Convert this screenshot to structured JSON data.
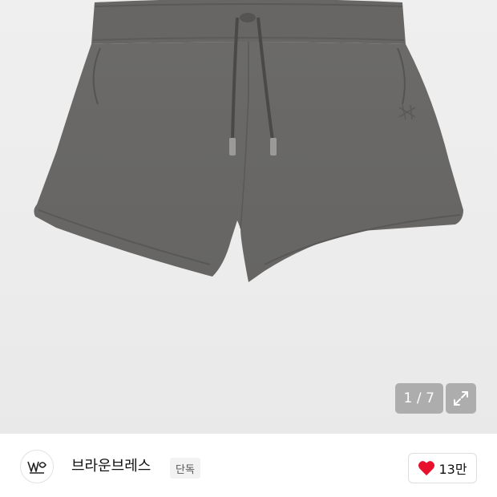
{
  "gallery": {
    "image_alt": "gray sweat shorts",
    "current_page": "1",
    "separator": "/",
    "total_pages": "7",
    "expand_icon": "expand-arrows-icon"
  },
  "brand": {
    "name": "브라운브레스",
    "badge": "단독",
    "logo_icon": "brand-logo-icon"
  },
  "like": {
    "icon": "heart-icon",
    "count": "13만",
    "color": "#e8112d"
  }
}
